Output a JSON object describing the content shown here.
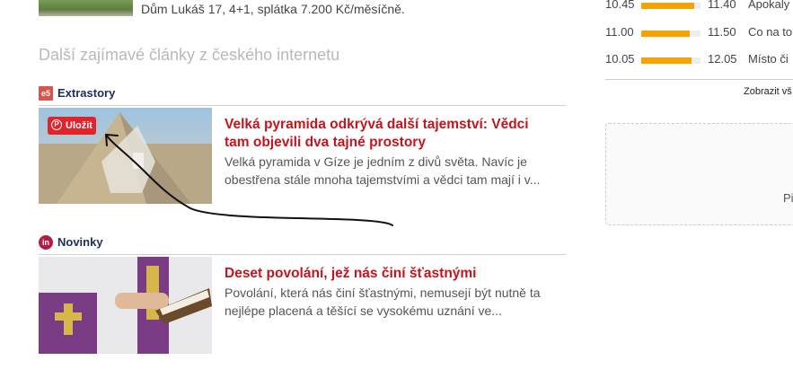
{
  "top_article": {
    "text": "Dům Lukáš 17, 4+1, splátka 7.200 Kč/měsíčně."
  },
  "section_title": "Další zajímavé články z českého internetu",
  "sources": [
    {
      "icon_text": "e5",
      "name": "Extrastory",
      "article": {
        "title": "Velká pyramida odkrývá další tajemství: Vědci tam objevili dva tajné prostory",
        "perex": "Velká pyramida v Gíze je jedním z divů světa. Navíc je obestřena stále mnoha tajemstvími a vědci tam mají i v..."
      },
      "save_button": "Uložit"
    },
    {
      "icon_text": "in",
      "name": "Novinky",
      "article": {
        "title": "Deset povolání, jež nás činí šťastnými",
        "perex": "Povolání, která nás činí šťastnými, nemusejí být nutně ta nejlépe placená a těšící se vysokému uznání ve..."
      }
    }
  ],
  "tv_schedule": [
    {
      "start": "10.45",
      "end": "11.40",
      "title": "Apokaly",
      "progress": 0.9
    },
    {
      "start": "11.00",
      "end": "11.50",
      "title": "Co na to",
      "progress": 0.82
    },
    {
      "start": "10.05",
      "end": "12.05",
      "title": "Místo či",
      "progress": 0.85
    }
  ],
  "show_all_link": "Zobrazit vš",
  "ad_text": "Pi",
  "colors": {
    "title_red": "#c5141b",
    "bar_orange": "#f5a300",
    "source_blue": "#1e2d5a"
  }
}
